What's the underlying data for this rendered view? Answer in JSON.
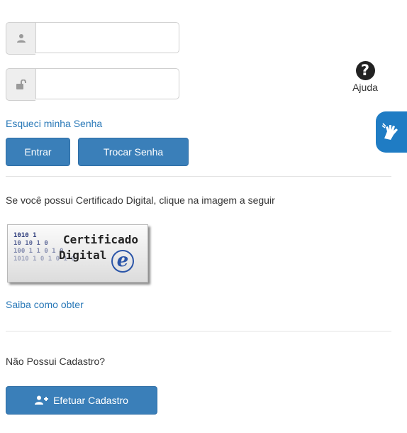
{
  "login": {
    "user_field": {
      "value": "",
      "placeholder": "",
      "icon": "user-icon"
    },
    "password_field": {
      "value": "",
      "placeholder": "",
      "icon": "unlock-icon"
    },
    "forgot_link": "Esqueci minha Senha",
    "enter_button": "Entrar",
    "change_password_button": "Trocar Senha"
  },
  "help": {
    "icon": "question-circle-icon",
    "label": "Ajuda"
  },
  "accessibility": {
    "icon": "sign-language-icon"
  },
  "certificate": {
    "intro": "Se você possui Certificado Digital, clique na imagem a seguir",
    "image": {
      "title_line1": "Certificado",
      "title_line2": "Digital",
      "emblem": "e",
      "digits": [
        "1010  1",
        "10 10 1 0",
        "100 1 1 0 1 0",
        "1010 1 0 1 0 1 0"
      ]
    },
    "how_to_link": "Saiba como obter"
  },
  "register": {
    "question": "Não Possui Cadastro?",
    "button": "Efetuar Cadastro",
    "button_icon": "user-plus-icon"
  },
  "colors": {
    "primary": "#3a7fb9",
    "link": "#2a79b8",
    "libras_badge": "#1f7cc4"
  }
}
